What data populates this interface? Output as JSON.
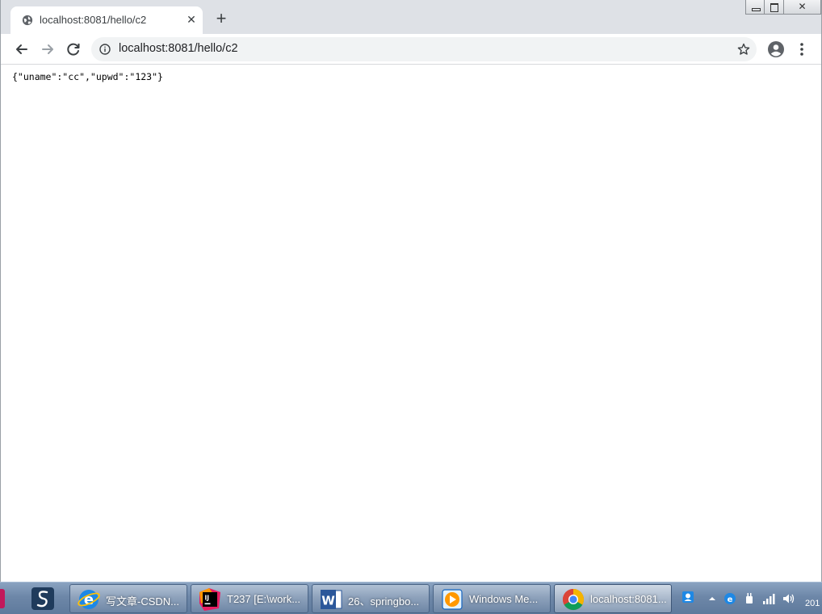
{
  "browser": {
    "tab": {
      "title": "localhost:8081/hello/c2",
      "close_glyph": "✕"
    },
    "new_tab_glyph": "+",
    "caption": {
      "close_glyph": "✕"
    },
    "omnibox": {
      "url": "localhost:8081/hello/c2"
    }
  },
  "page": {
    "body_text": "{\"uname\":\"cc\",\"upwd\":\"123\"}"
  },
  "taskbar": {
    "buttons": [
      {
        "label": "写文章-CSDN...",
        "icon": "ie-icon"
      },
      {
        "label": "T237 [E:\\work...",
        "icon": "intellij-icon"
      },
      {
        "label": "26、springbo...",
        "icon": "word-icon"
      },
      {
        "label": "Windows Me...",
        "icon": "media-player-icon"
      },
      {
        "label": "localhost:8081...",
        "icon": "chrome-icon"
      }
    ],
    "clock": "201"
  },
  "colors": {
    "tabstrip": "#dee1e6",
    "omnibox": "#f1f3f4",
    "taskbar": "#6d87a8"
  }
}
